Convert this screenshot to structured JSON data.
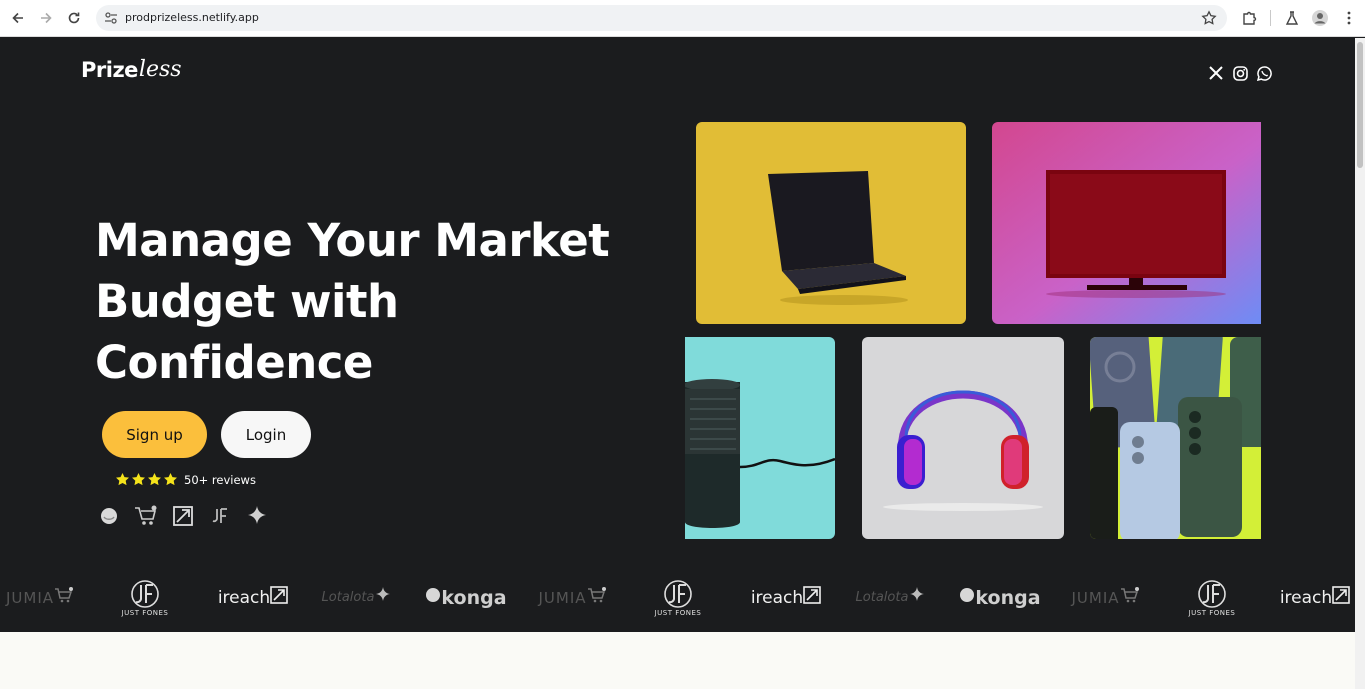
{
  "browser": {
    "url": "prodprizeless.netlify.app",
    "icons": [
      "back-icon",
      "forward-icon",
      "reload-icon",
      "site-settings-icon",
      "bookmark-star-icon",
      "extensions-icon",
      "labs-icon",
      "profile-icon",
      "menu-icon"
    ]
  },
  "header": {
    "logo_part1": "Prize",
    "logo_part2": "less",
    "socials": [
      "x-icon",
      "instagram-icon",
      "whatsapp-icon"
    ]
  },
  "hero": {
    "headline_line1": "Manage Your Market",
    "headline_line2": "Budget with Confidence",
    "signup_label": "Sign up",
    "login_label": "Login",
    "reviews_text": "50+ reviews",
    "rating_stars": 4,
    "brand_icons": [
      "konga-icon",
      "jumia-cart-icon",
      "ireach-icon",
      "justfones-icon",
      "sparkle-icon"
    ]
  },
  "products": [
    {
      "name": "laptop",
      "bg": "#e1bd36"
    },
    {
      "name": "monitor",
      "bg": "#d44aa0"
    },
    {
      "name": "speaker",
      "bg": "#7fdcdb"
    },
    {
      "name": "headphones",
      "bg": "#d8d8d8"
    },
    {
      "name": "phones",
      "bg": "#d4f03a"
    }
  ],
  "partners": [
    {
      "name": "JUMIA",
      "kind": "jumia"
    },
    {
      "name": "JUST FONES",
      "kind": "just"
    },
    {
      "name": "ireach",
      "kind": "ireach"
    },
    {
      "name": "Lotalota",
      "kind": "lota"
    },
    {
      "name": "konga",
      "kind": "konga"
    },
    {
      "name": "JUMIA",
      "kind": "jumia"
    },
    {
      "name": "JUST FONES",
      "kind": "just"
    },
    {
      "name": "ireach",
      "kind": "ireach"
    },
    {
      "name": "Lotalota",
      "kind": "lota"
    },
    {
      "name": "konga",
      "kind": "konga"
    },
    {
      "name": "JUMIA",
      "kind": "jumia"
    },
    {
      "name": "JUST FONES",
      "kind": "just"
    },
    {
      "name": "ireach",
      "kind": "ireach"
    }
  ],
  "colors": {
    "page_bg": "#1b1c1e",
    "accent": "#fbbf3c",
    "star": "#f5e31b",
    "section_bg": "#fafaf6"
  }
}
